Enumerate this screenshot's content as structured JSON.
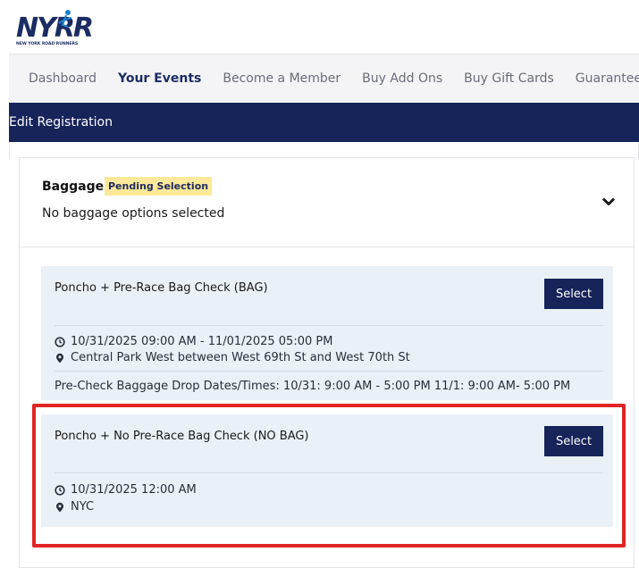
{
  "header": {
    "logo_text": "NYRR",
    "logo_subtext": "NEW YORK ROAD RUNNERS"
  },
  "nav": {
    "items": [
      {
        "label": "Dashboard",
        "active": false
      },
      {
        "label": "Your Events",
        "active": true
      },
      {
        "label": "Become a Member",
        "active": false
      },
      {
        "label": "Buy Add Ons",
        "active": false
      },
      {
        "label": "Buy Gift Cards",
        "active": false
      },
      {
        "label": "Guaranteed Ent",
        "active": false
      }
    ]
  },
  "subbar": {
    "title": "Edit Registration"
  },
  "baggage": {
    "title": "Baggage",
    "badge": "Pending Selection",
    "status": "No baggage options selected",
    "options": [
      {
        "title": "Poncho + Pre-Race Bag Check (BAG)",
        "button": "Select",
        "datetime": "10/31/2025 09:00 AM - 11/01/2025 05:00 PM",
        "location": "Central Park West between West 69th St and West 70th St",
        "note": "Pre-Check Baggage Drop Dates/Times: 10/31: 9:00 AM - 5:00 PM 11/1: 9:00 AM- 5:00 PM"
      },
      {
        "title": "Poncho + No Pre-Race Bag Check (NO BAG)",
        "button": "Select",
        "datetime": "10/31/2025 12:00 AM",
        "location": "NYC"
      }
    ]
  },
  "icons": {
    "clock": "clock-icon",
    "location": "map-pin-icon",
    "chevron": "chevron-down-icon"
  },
  "colors": {
    "navy": "#16245a",
    "badge": "#fce99a",
    "option_bg": "#e9f0f6",
    "highlight": "#e02424"
  }
}
